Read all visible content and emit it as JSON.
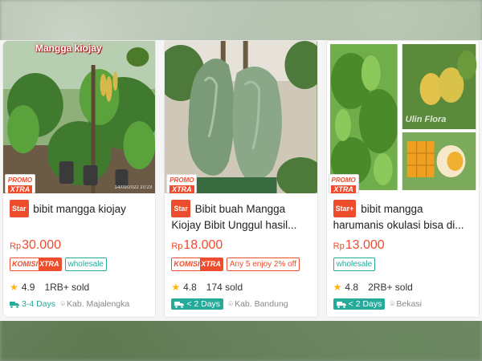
{
  "cards": [
    {
      "image_text": "Mangga kiojay",
      "image_date": "14/09/2022 10:23",
      "promo_line1": "PROMO",
      "promo_line2": "XTRA",
      "badge": "Star",
      "title": "bibit mangga kiojay",
      "currency": "Rp",
      "price": "30.000",
      "tags": [
        {
          "type": "komisi",
          "k1": "KOMISI",
          "k2": "XTRA"
        },
        {
          "type": "wholesale",
          "label": "wholesale"
        }
      ],
      "rating": "4.9",
      "sold": "1RB+ sold",
      "shipping": "3-4 Days",
      "shipping_style": "text",
      "location": "Kab. Majalengka"
    },
    {
      "promo_line1": "PROMO",
      "promo_line2": "XTRA",
      "badge": "Star",
      "title": "Bibit buah Mangga Kiojay Bibit Unggul hasil...",
      "currency": "Rp",
      "price": "18.000",
      "tags": [
        {
          "type": "komisi",
          "k1": "KOMISI",
          "k2": "XTRA"
        },
        {
          "type": "discount",
          "label": "Any 5 enjoy 2% off"
        }
      ],
      "rating": "4.8",
      "sold": "174 sold",
      "shipping": "< 2 Days",
      "shipping_style": "pill",
      "location": "Kab. Bandung"
    },
    {
      "image_text": "Ulin Flora",
      "promo_line1": "PROMO",
      "promo_line2": "XTRA",
      "badge": "Star+",
      "title": "bibit mangga harumanis okulasi bisa di...",
      "currency": "Rp",
      "price": "13.000",
      "tags": [
        {
          "type": "wholesale",
          "label": "wholesale"
        }
      ],
      "rating": "4.8",
      "sold": "2RB+ sold",
      "shipping": "< 2 Days",
      "shipping_style": "pill",
      "location": "Bekasi"
    }
  ],
  "colors": {
    "accent": "#ee4d2d",
    "teal": "#26aa99",
    "star": "#ffb400"
  }
}
